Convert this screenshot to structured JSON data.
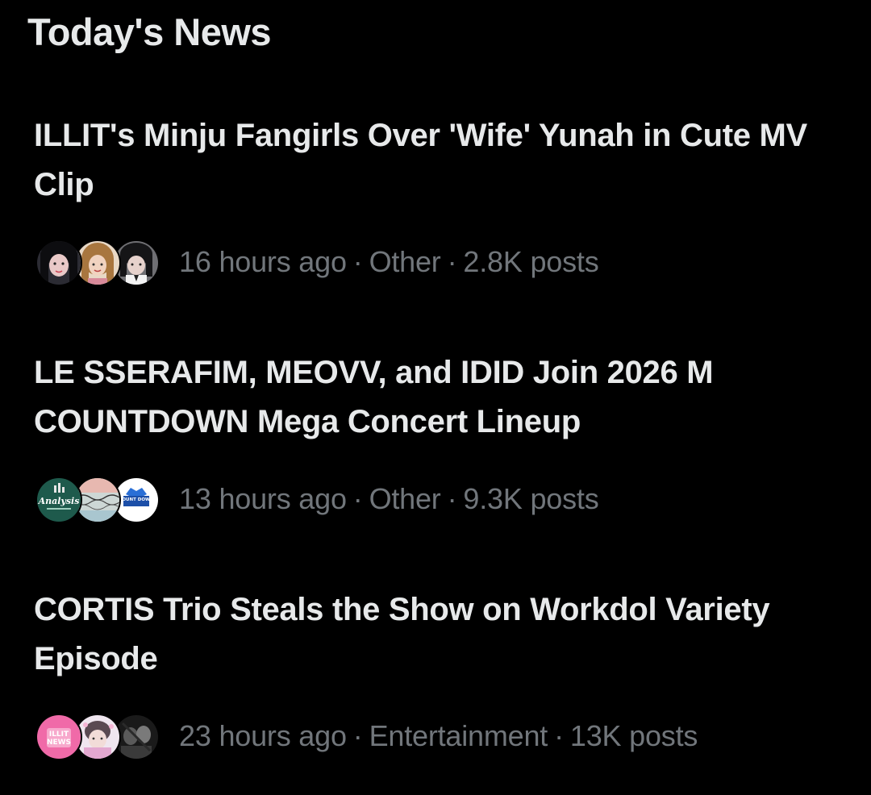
{
  "section": {
    "title": "Today's News"
  },
  "news": [
    {
      "headline": "ILLIT's Minju Fangirls Over 'Wife' Yunah in Cute MV Clip",
      "time": "16 hours ago",
      "category": "Other",
      "posts": "2.8K posts",
      "avatars": [
        "person-photo-icon",
        "person-photo-icon",
        "person-photo-icon"
      ]
    },
    {
      "headline": "LE SSERAFIM, MEOVV, and IDID Join 2026 M COUNTDOWN Mega Concert Lineup",
      "time": "13 hours ago",
      "category": "Other",
      "posts": "9.3K posts",
      "avatars": [
        "analysis-logo-icon",
        "abstract-wave-icon",
        "countdown-logo-icon"
      ],
      "avatar_labels": [
        "Analysis",
        "COUNT DOWN"
      ]
    },
    {
      "headline": "CORTIS Trio Steals the Show on Workdol Variety Episode",
      "time": "23 hours ago",
      "category": "Entertainment",
      "posts": "13K posts",
      "avatars": [
        "illit-news-logo-icon",
        "person-photo-icon",
        "person-photo-icon"
      ],
      "avatar_labels": [
        "ILLIT",
        "NEWS"
      ]
    }
  ],
  "separator": "·",
  "colors": {
    "background": "#000000",
    "primary_text": "#e7e9ea",
    "secondary_text": "#71767b"
  }
}
